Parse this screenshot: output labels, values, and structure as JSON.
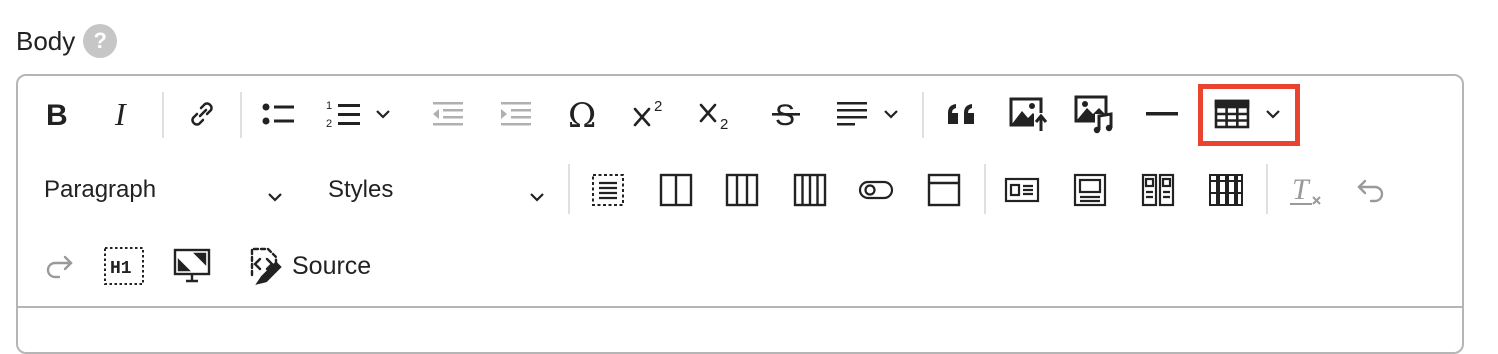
{
  "field": {
    "label": "Body",
    "help": "?"
  },
  "toolbar": {
    "row1": [
      "bold",
      "italic",
      "link",
      "bulleted-list",
      "numbered-list",
      "numbered-list-dropdown",
      "outdent",
      "indent",
      "special-characters",
      "superscript",
      "subscript",
      "strikethrough",
      "alignment",
      "alignment-dropdown",
      "block-quote",
      "insert-image",
      "insert-media",
      "horizontal-line",
      "insert-table",
      "insert-table-dropdown"
    ],
    "paragraph_select": "Paragraph",
    "styles_select": "Styles",
    "source_label": "Source",
    "heading_icon_text": "H1",
    "subscript_glyph": "2",
    "superscript_glyph": "2",
    "highlighted": "insert-table-button"
  },
  "colors": {
    "highlight": "#e8442f",
    "border": "#b5b5b5",
    "icon": "#222222",
    "disabled": "#9a9a9a"
  }
}
